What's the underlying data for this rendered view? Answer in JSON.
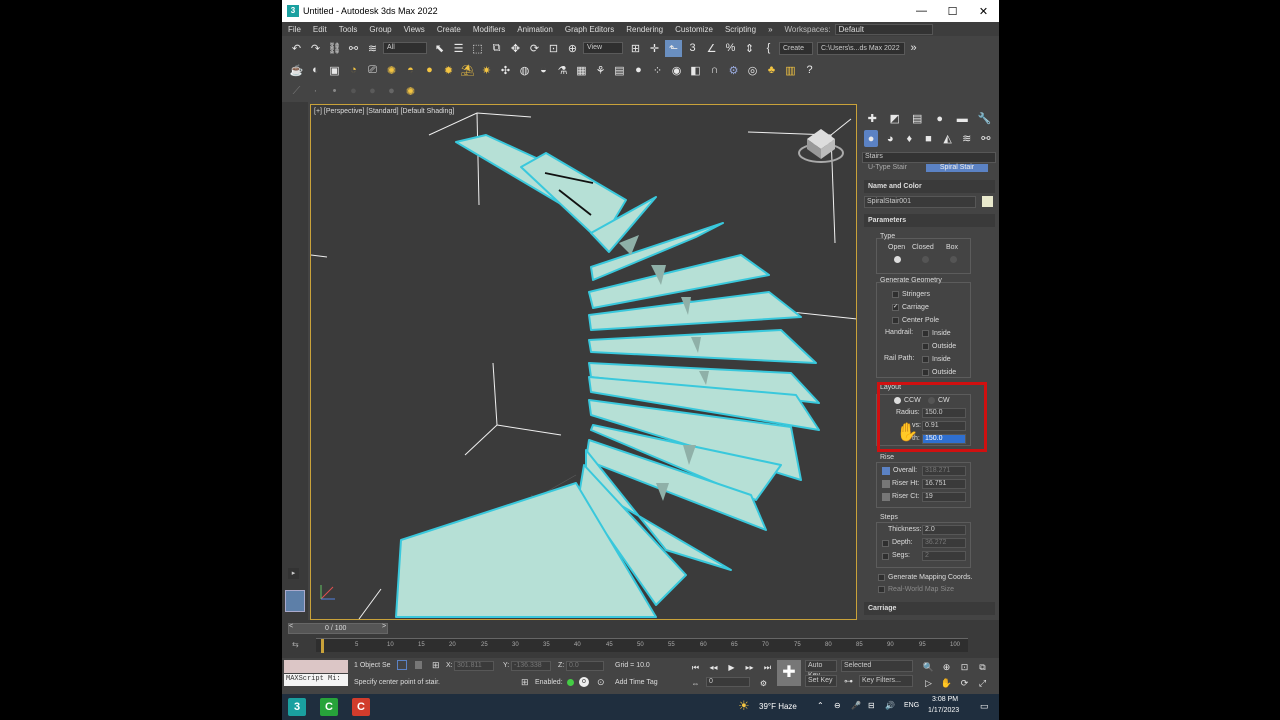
{
  "window": {
    "title": "Untitled - Autodesk 3ds Max 2022",
    "app_icon": "3"
  },
  "menu": [
    "File",
    "Edit",
    "Tools",
    "Group",
    "Views",
    "Create",
    "Modifiers",
    "Animation",
    "Graph Editors",
    "Rendering",
    "Customize",
    "Scripting"
  ],
  "workspace": {
    "label": "Workspaces:",
    "value": "Default"
  },
  "toolbar": {
    "selection_filter": "All",
    "view_select": "View",
    "create_btn": "Create",
    "project_path": "C:\\Users\\s...ds Max 2022"
  },
  "viewport": {
    "label": "[+] [Perspective] [Standard] [Default Shading]"
  },
  "command_panel": {
    "category": "Stairs",
    "types": [
      "U-Type Stair",
      "Spiral Stair"
    ],
    "name_color_header": "Name and Color",
    "object_name": "SpiralStair001",
    "parameters_header": "Parameters",
    "type": {
      "label": "Type",
      "options": [
        "Open",
        "Closed",
        "Box"
      ]
    },
    "generate_geometry": {
      "label": "Generate Geometry",
      "stringers": "Stringers",
      "carriage": "Carriage",
      "center_pole": "Center Pole",
      "handrail": "Handrail:",
      "rail_path": "Rail Path:",
      "inside": "Inside",
      "outside": "Outside"
    },
    "layout": {
      "label": "Layout",
      "ccw": "CCW",
      "cw": "CW",
      "radius_label": "Radius:",
      "radius": "150.0",
      "revs_label": "vs:",
      "revs": "0.91",
      "width_label": "th:",
      "width": "150.0"
    },
    "rise": {
      "label": "Rise",
      "overall_label": "Overall:",
      "overall": "318.271",
      "riser_ht_label": "Riser Ht:",
      "riser_ht": "16.751",
      "riser_ct_label": "Riser Ct:",
      "riser_ct": "19"
    },
    "steps": {
      "label": "Steps",
      "thickness_label": "Thickness:",
      "thickness": "2.0",
      "depth_label": "Depth:",
      "depth": "36.272",
      "segs_label": "Segs:",
      "segs": "2"
    },
    "mapping": "Generate Mapping Coords.",
    "real_world": "Real-World Map Size",
    "carriage_header": "Carriage"
  },
  "timeline": {
    "frame": "0 / 100",
    "ticks": [
      "5",
      "10",
      "15",
      "20",
      "25",
      "30",
      "35",
      "40",
      "45",
      "50",
      "55",
      "60",
      "65",
      "70",
      "75",
      "80",
      "85",
      "90",
      "95",
      "100"
    ]
  },
  "status": {
    "maxscript": "MAXScript Mi:",
    "objects": "1 Object Se",
    "prompt": "Specify center point of stair.",
    "x_label": "X:",
    "x": "301.811",
    "y_label": "Y:",
    "y": "-136.338",
    "z_label": "Z:",
    "z": "0.0",
    "grid": "Grid = 10.0",
    "enabled": "Enabled:",
    "add_time_tag": "Add Time Tag",
    "auto_key": "Auto Key",
    "set_key": "Set Key",
    "selected": "Selected",
    "key_filters": "Key Filters...",
    "frame_field": "0"
  },
  "taskbar": {
    "weather": "39°F Haze",
    "time": "3:08 PM",
    "date": "1/17/2023",
    "lang": "ENG"
  },
  "colors": {
    "stair": "#b6e0d6",
    "stair_outline": "#39c8dc",
    "annotation": "#d01010",
    "viewport_border": "#c9a23a"
  }
}
